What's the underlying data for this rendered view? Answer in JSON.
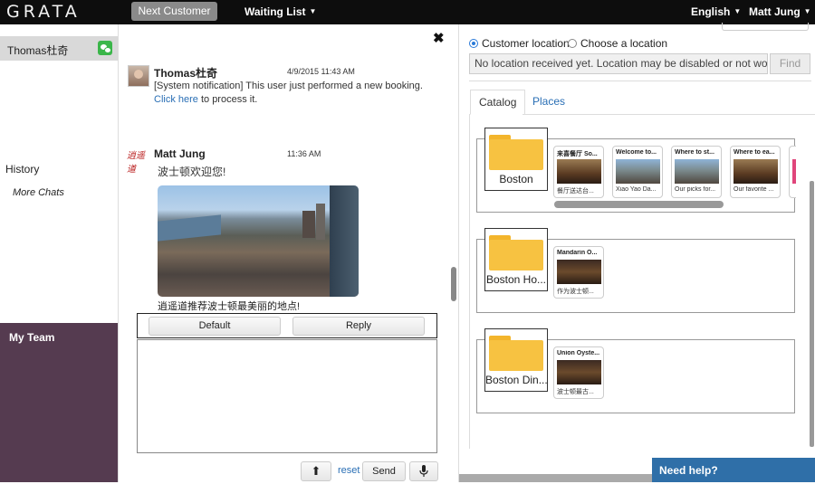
{
  "topbar": {
    "logo": "GRATA",
    "next_customer": "Next Customer",
    "waiting_list": "Waiting List",
    "language": "English",
    "user": "Matt Jung"
  },
  "sidebar": {
    "active_chat": "Thomas杜奇",
    "history": "History",
    "more_chats": "More Chats",
    "my_team": "My Team"
  },
  "chat": {
    "messages": [
      {
        "sender": "Thomas杜奇",
        "time": "4/9/2015 11:43 AM",
        "text": "[System notification] This user just performed a new booking.",
        "link": "Click here",
        "link_suffix": " to process it."
      },
      {
        "sender": "Matt Jung",
        "time": "11:36 AM",
        "text": "波士顿欢迎您!",
        "caption": "逍遥道推荐波士顿最美丽的地点!"
      }
    ],
    "quick_replies": [
      "Default",
      "Reply"
    ],
    "reset": "reset",
    "send": "Send"
  },
  "location": {
    "option_customer": "Customer location",
    "option_choose": "Choose a location",
    "input_value": "No location received yet.  Location may be disabled or not working.",
    "find": "Find"
  },
  "tabs": [
    "Catalog",
    "Places"
  ],
  "catalog": [
    {
      "folder": "Boston",
      "cards": [
        {
          "title": "来喜餐厅 So...",
          "sub": "餐厅送达台..."
        },
        {
          "title": "Welcome to...",
          "sub": "Xiao Yao Da..."
        },
        {
          "title": "Where to st...",
          "sub": "Our picks for..."
        },
        {
          "title": "Where to ea...",
          "sub": "Our favorite ..."
        }
      ]
    },
    {
      "folder": "Boston Ho...",
      "cards": [
        {
          "title": "Mandarin O...",
          "sub": "作为波士顿..."
        }
      ]
    },
    {
      "folder": "Boston Din...",
      "cards": [
        {
          "title": "Union Oyste...",
          "sub": "波士顿最古..."
        }
      ]
    }
  ],
  "help": "Need help?"
}
